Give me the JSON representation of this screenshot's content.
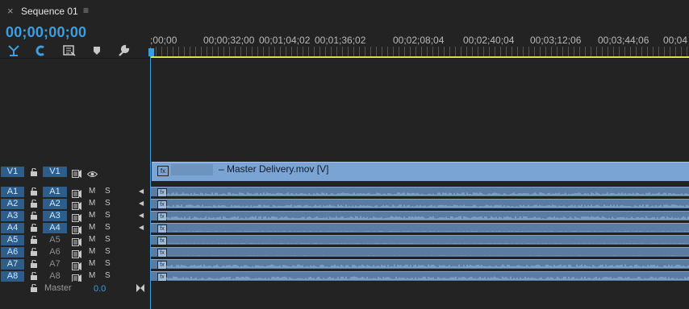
{
  "tab": {
    "close_glyph": "×",
    "title": "Sequence 01",
    "menu_glyph": "≡"
  },
  "timecode": "00;00;00;00",
  "toolbar": {
    "icons": [
      "snap-icon",
      "linked-selection-icon",
      "insert-nest-icon",
      "add-marker-icon",
      "wrench-settings-icon"
    ]
  },
  "ruler": {
    "labels": [
      ";00;00",
      "00;00;32;00",
      "00;01;04;02",
      "00;01;36;02",
      "00;02;08;04",
      "00;02;40;04",
      "00;03;12;06",
      "00;03;44;06",
      "00;04"
    ]
  },
  "video_track": {
    "target": "V1",
    "source": "V1",
    "clip_name": "– Master Delivery.mov [V]",
    "fx": "fx"
  },
  "audio_tracks": [
    {
      "target": "A1",
      "source": "A1",
      "source_on": true,
      "m": "M",
      "s": "S",
      "fx": "fx"
    },
    {
      "target": "A2",
      "source": "A2",
      "source_on": true,
      "m": "M",
      "s": "S",
      "fx": "fx"
    },
    {
      "target": "A3",
      "source": "A3",
      "source_on": true,
      "m": "M",
      "s": "S",
      "fx": "fx"
    },
    {
      "target": "A4",
      "source": "A4",
      "source_on": true,
      "m": "M",
      "s": "S",
      "fx": "fx"
    },
    {
      "target": "A5",
      "source": "A5",
      "source_on": false,
      "m": "M",
      "s": "S",
      "fx": "fx"
    },
    {
      "target": "A6",
      "source": "A6",
      "source_on": false,
      "m": "M",
      "s": "S",
      "fx": "fx"
    },
    {
      "target": "A7",
      "source": "A7",
      "source_on": false,
      "m": "M",
      "s": "S",
      "fx": "fx"
    },
    {
      "target": "A8",
      "source": "A8",
      "source_on": false,
      "m": "M",
      "s": "S",
      "fx": "fx"
    }
  ],
  "master": {
    "label": "Master",
    "volume": "0.0"
  },
  "colors": {
    "accent": "#3c9ee0",
    "work_area": "#e9d94a",
    "audio_clip": "#5a7ca3",
    "video_clip": "#7aa4d3",
    "target_on": "#2d5d8a"
  }
}
